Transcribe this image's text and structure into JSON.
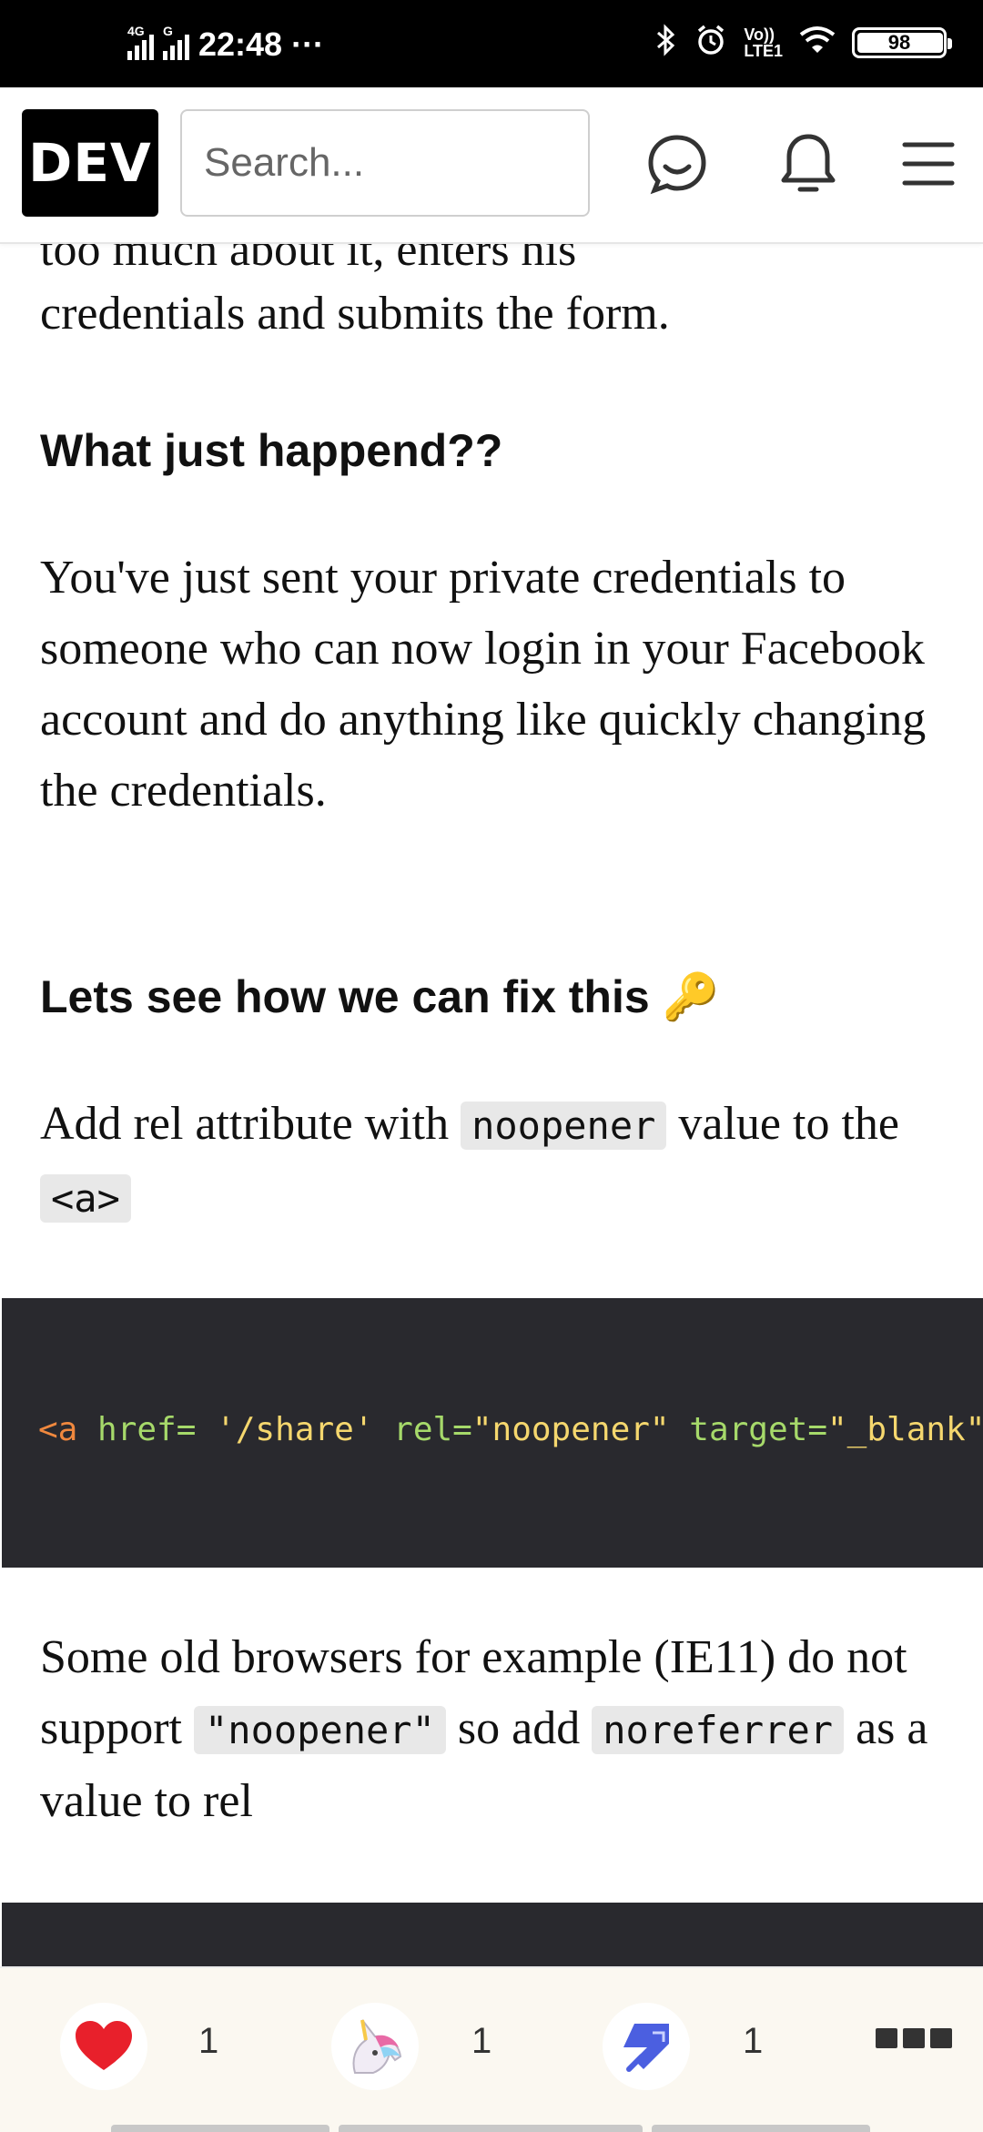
{
  "status_bar": {
    "time": "22:48",
    "dots": "···",
    "sim1_tag": "4G",
    "sim2_tag": "G",
    "volte_line1": "Vo))",
    "volte_line2": "LTE1",
    "battery_level": "98"
  },
  "header": {
    "logo_text": "DEV",
    "search_placeholder": "Search..."
  },
  "article": {
    "partial_line_top": "too much about it, enters his",
    "partial_line_2": "credentials and submits the form.",
    "heading_1": "What just happend??",
    "para_1": "You've just sent your private credentials to someone who can now login in your Facebook account and do anything like quickly changing the credentials.",
    "heading_2": "Lets see how we can fix this",
    "heading_2_emoji": "🔑",
    "para_2_before": "Add rel attribute with ",
    "para_2_code_1": "noopener",
    "para_2_mid": " value to the ",
    "para_2_code_2": "<a>",
    "code_line": {
      "tag": "<a",
      "attr1": " href=",
      "val1": " '/share'",
      "attr2": " rel=",
      "val2": "\"noopener\"",
      "attr3": " target=",
      "val3": "\"_blank\">"
    },
    "para_3_before": "Some old browsers for example (IE11) do not support ",
    "para_3_code_1": "\"noopener\"",
    "para_3_mid": " so add ",
    "para_3_code_2": "noreferrer",
    "para_3_after": " as a value to rel"
  },
  "reactions": {
    "heart_count": "1",
    "unicorn_count": "1",
    "bookmark_count": "1"
  },
  "colors": {
    "code_bg": "#29292e",
    "code_tag": "#f0883e",
    "code_attr": "#a6d96a",
    "code_string": "#f5d76e"
  }
}
